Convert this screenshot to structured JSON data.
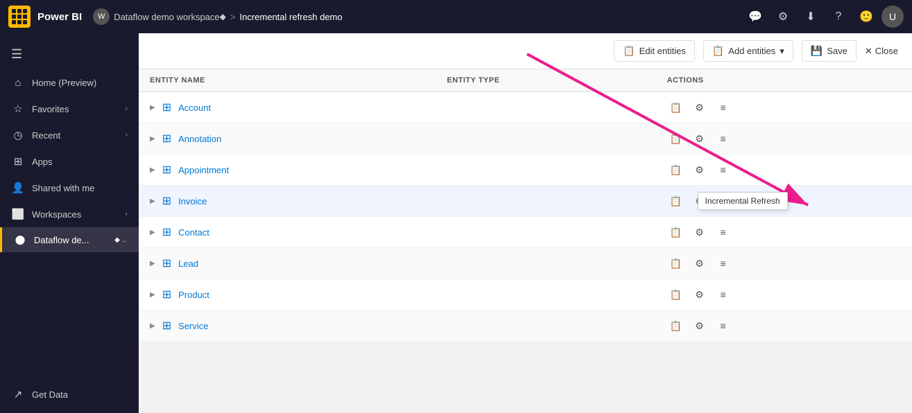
{
  "topbar": {
    "waffle_label": "App launcher",
    "logo": "Power BI",
    "breadcrumb": {
      "workspace_label": "Dataflow demo workspace",
      "separator": ">",
      "current": "Incremental refresh demo"
    },
    "icons": [
      "chat",
      "settings",
      "download",
      "help",
      "smiley",
      "user"
    ]
  },
  "sidebar": {
    "hamburger": "☰",
    "items": [
      {
        "id": "home",
        "label": "Home (Preview)",
        "icon": "⌂",
        "chevron": false,
        "active": false
      },
      {
        "id": "favorites",
        "label": "Favorites",
        "icon": "☆",
        "chevron": true,
        "active": false
      },
      {
        "id": "recent",
        "label": "Recent",
        "icon": "◷",
        "chevron": true,
        "active": false
      },
      {
        "id": "apps",
        "label": "Apps",
        "icon": "⊞",
        "chevron": false,
        "active": false
      },
      {
        "id": "shared",
        "label": "Shared with me",
        "icon": "👤",
        "chevron": false,
        "active": false
      },
      {
        "id": "workspaces",
        "label": "Workspaces",
        "icon": "◫",
        "chevron": true,
        "active": false
      },
      {
        "id": "dataflow",
        "label": "Dataflow de...",
        "icon": "◈",
        "chevron": true,
        "active": true
      }
    ],
    "bottom": {
      "id": "getdata",
      "label": "Get Data",
      "icon": "↗"
    }
  },
  "action_bar": {
    "edit_entities": "Edit entities",
    "add_entities": "Add entities",
    "add_entities_chevron": "▾",
    "save": "Save",
    "close": "Close"
  },
  "table": {
    "columns": [
      {
        "id": "entity-name",
        "label": "ENTITY NAME"
      },
      {
        "id": "entity-type",
        "label": "ENTITY TYPE"
      },
      {
        "id": "actions",
        "label": "ACTIONS"
      }
    ],
    "rows": [
      {
        "id": "account",
        "name": "Account",
        "type": "",
        "highlighted": false
      },
      {
        "id": "annotation",
        "name": "Annotation",
        "type": "",
        "highlighted": false
      },
      {
        "id": "appointment",
        "name": "Appointment",
        "type": "",
        "highlighted": false
      },
      {
        "id": "invoice",
        "name": "Invoice",
        "type": "",
        "highlighted": true
      },
      {
        "id": "contact",
        "name": "Contact",
        "type": "",
        "highlighted": false
      },
      {
        "id": "lead",
        "name": "Lead",
        "type": "",
        "highlighted": false
      },
      {
        "id": "product",
        "name": "Product",
        "type": "",
        "highlighted": false
      },
      {
        "id": "service",
        "name": "Service",
        "type": "",
        "highlighted": false
      }
    ]
  },
  "tooltip": {
    "text": "Incremental Refresh"
  },
  "icons": {
    "edit": "📋",
    "settings": "⚙",
    "incremental": "≡"
  }
}
